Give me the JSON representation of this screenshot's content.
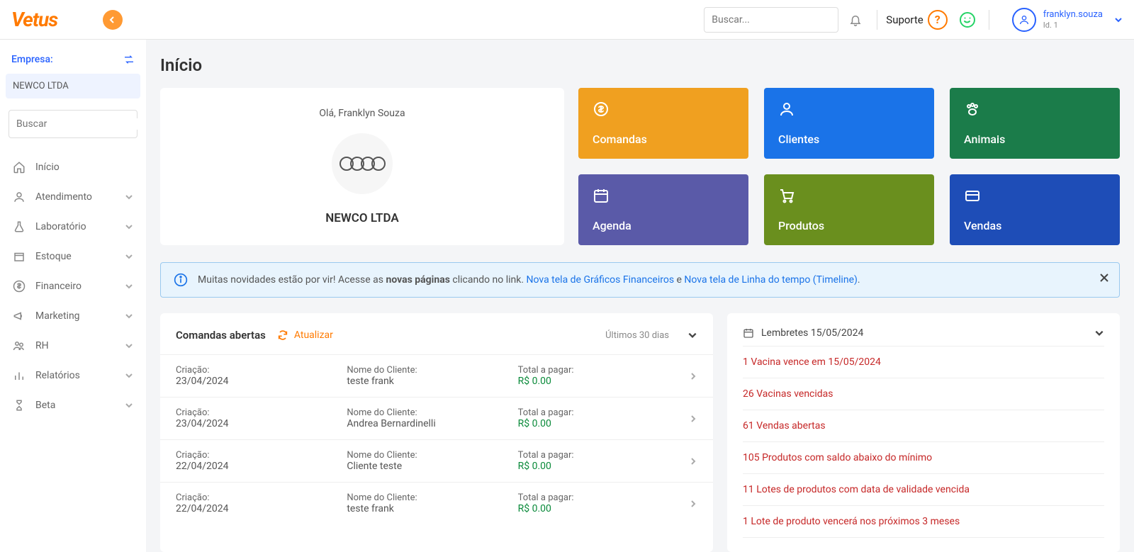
{
  "header": {
    "logo_text": "Vetus",
    "search_placeholder": "Buscar...",
    "suporte_label": "Suporte",
    "username": "franklyn.souza",
    "user_id": "Id. 1"
  },
  "sidebar": {
    "empresa_label": "Empresa:",
    "empresa_name": "NEWCO LTDA",
    "search_placeholder": "Buscar",
    "items": [
      {
        "label": "Início",
        "icon": "home",
        "expandable": false
      },
      {
        "label": "Atendimento",
        "icon": "person",
        "expandable": true
      },
      {
        "label": "Laboratório",
        "icon": "flask",
        "expandable": true
      },
      {
        "label": "Estoque",
        "icon": "box",
        "expandable": true
      },
      {
        "label": "Financeiro",
        "icon": "dollar",
        "expandable": true
      },
      {
        "label": "Marketing",
        "icon": "megaphone",
        "expandable": true
      },
      {
        "label": "RH",
        "icon": "people",
        "expandable": true
      },
      {
        "label": "Relatórios",
        "icon": "chart",
        "expandable": true
      },
      {
        "label": "Beta",
        "icon": "hourglass",
        "expandable": true
      }
    ]
  },
  "page_title": "Início",
  "welcome": {
    "greeting": "Olá, Franklyn Souza",
    "company": "NEWCO LTDA"
  },
  "tiles": [
    {
      "label": "Comandas",
      "color": "t-orange",
      "icon": "receipt"
    },
    {
      "label": "Clientes",
      "color": "t-blue",
      "icon": "user"
    },
    {
      "label": "Animais",
      "color": "t-green",
      "icon": "paw"
    },
    {
      "label": "Agenda",
      "color": "t-purple",
      "icon": "calendar"
    },
    {
      "label": "Produtos",
      "color": "t-olive",
      "icon": "cart"
    },
    {
      "label": "Vendas",
      "color": "t-navy",
      "icon": "card"
    }
  ],
  "banner": {
    "prefix": "Muitas novidades estão por vir! Acesse as ",
    "bold": "novas páginas",
    "mid": " clicando no link. ",
    "link1": "Nova tela de Gráficos Financeiros",
    "and": " e ",
    "link2": "Nova tela de Linha do tempo (Timeline)",
    "dot": "."
  },
  "comandas": {
    "title": "Comandas abertas",
    "refresh": "Atualizar",
    "period": "Últimos 30 dias",
    "col_criacao": "Criação:",
    "col_cliente": "Nome do Cliente:",
    "col_total": "Total a pagar:",
    "rows": [
      {
        "date": "23/04/2024",
        "client": "teste frank",
        "total": "R$ 0.00"
      },
      {
        "date": "23/04/2024",
        "client": "Andrea Bernardinelli",
        "total": "R$ 0.00"
      },
      {
        "date": "22/04/2024",
        "client": "Cliente teste",
        "total": "R$ 0.00"
      },
      {
        "date": "22/04/2024",
        "client": "teste frank",
        "total": "R$ 0.00"
      }
    ]
  },
  "lembretes": {
    "title": "Lembretes 15/05/2024",
    "items": [
      "1 Vacina vence em 15/05/2024",
      "26 Vacinas vencidas",
      "61 Vendas abertas",
      "105 Produtos com saldo abaixo do mínimo",
      "11 Lotes de produtos com data de validade vencida",
      "1 Lote de produto vencerá nos próximos 3 meses"
    ]
  }
}
